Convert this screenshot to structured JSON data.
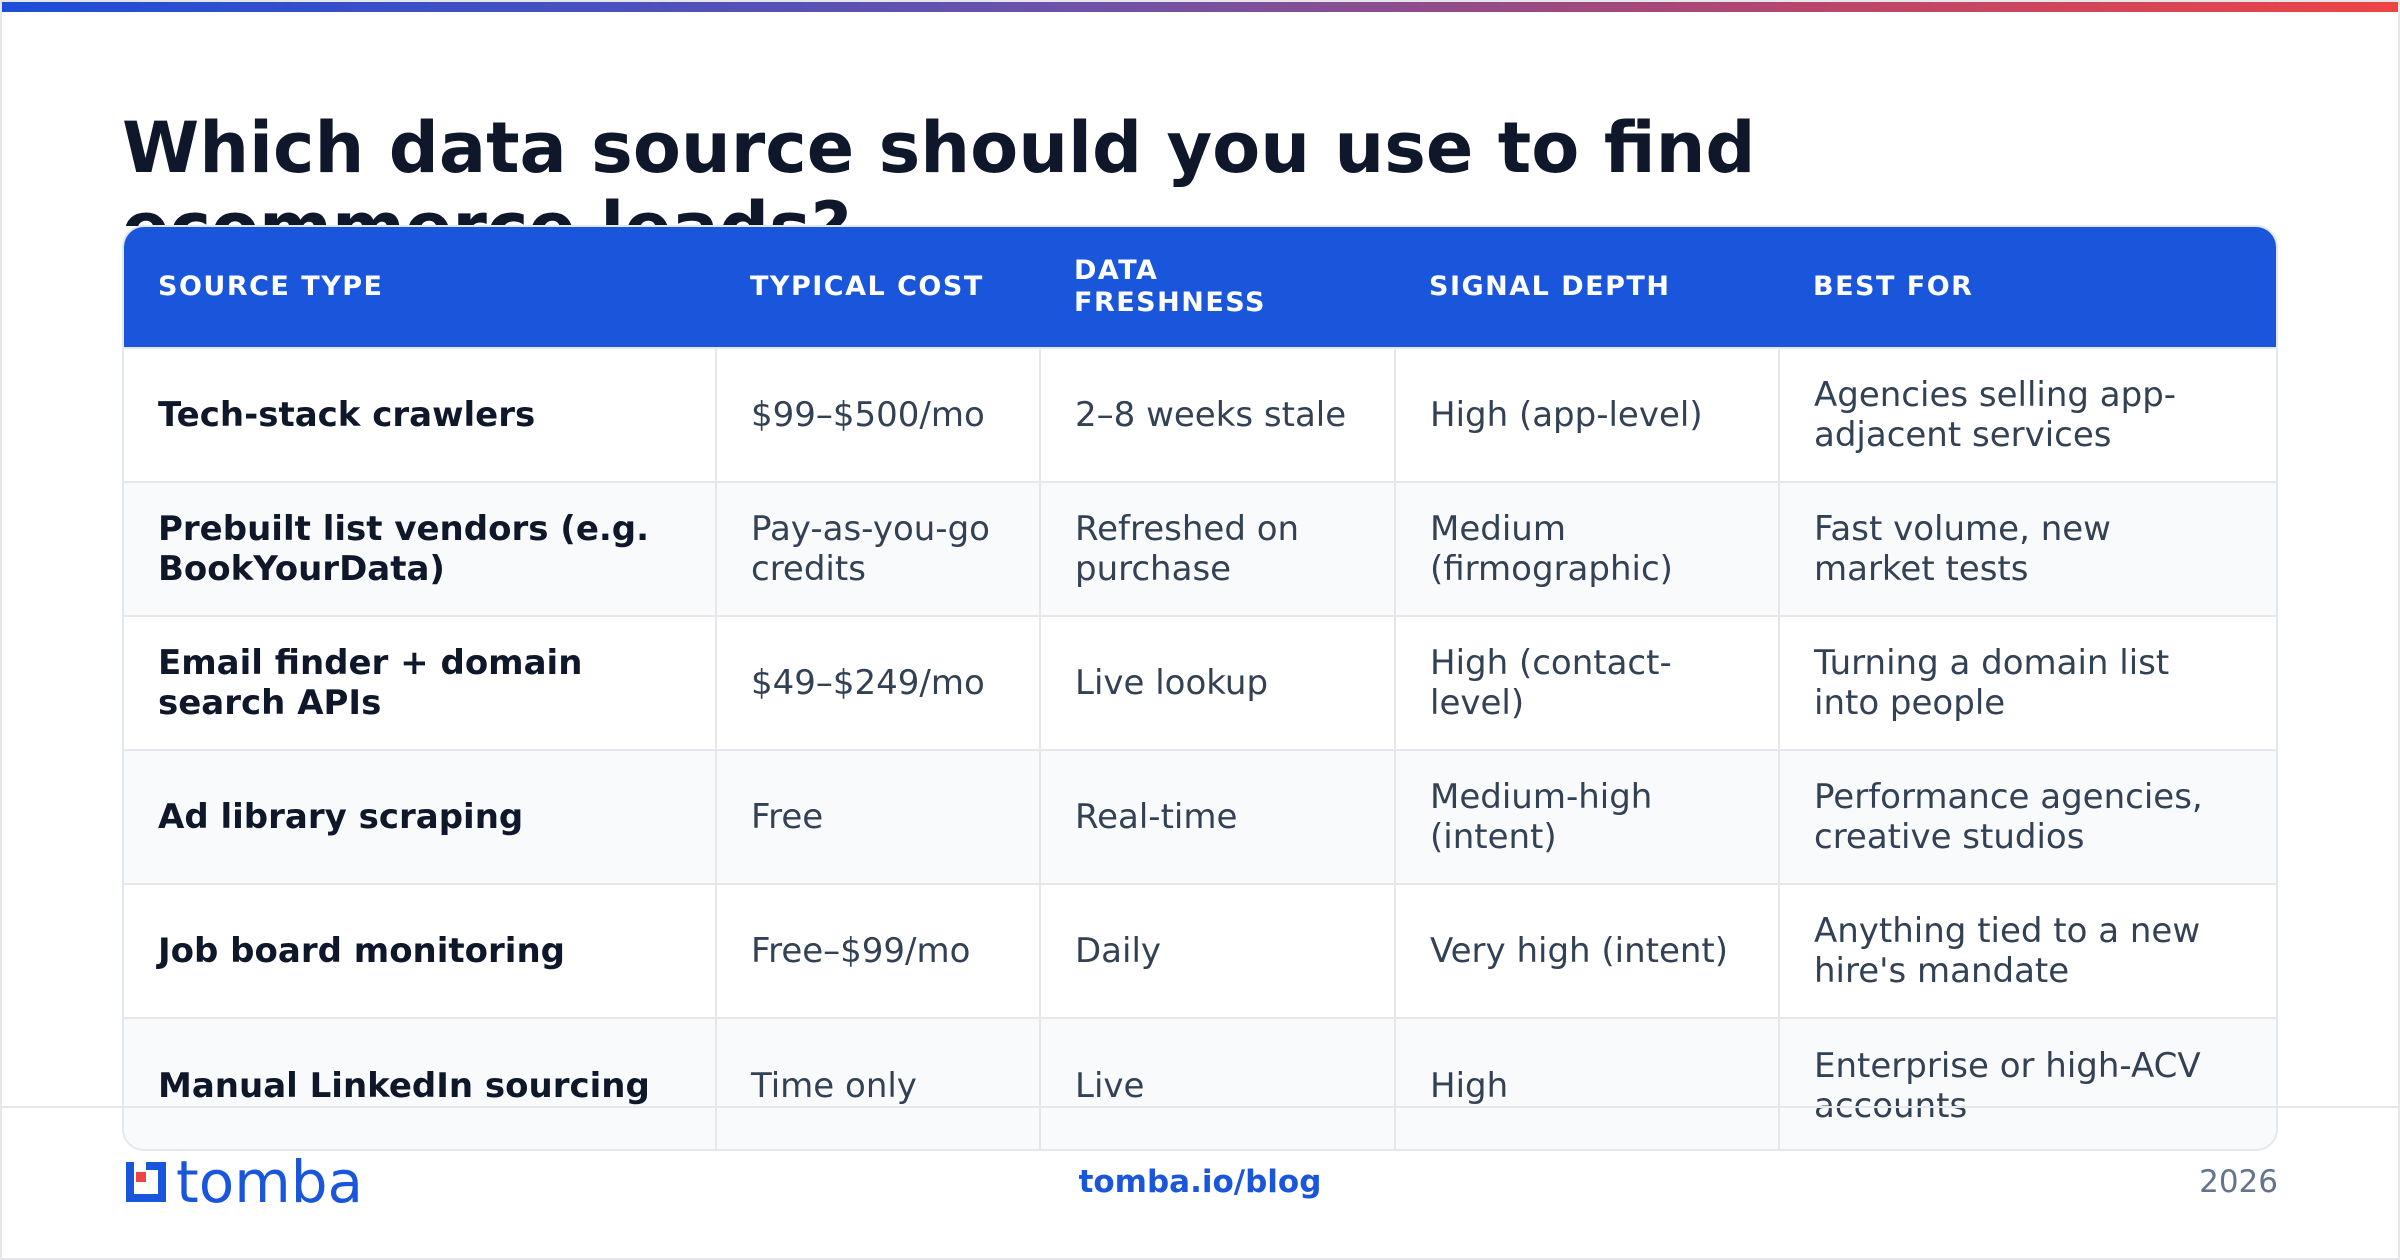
{
  "slide": {
    "title": "Which data source should you use to find ecommerce leads?"
  },
  "table": {
    "headers": [
      "Source type",
      "Typical cost",
      "Data freshness",
      "Signal depth",
      "Best for"
    ],
    "rows": [
      [
        "Tech-stack crawlers",
        "$99–$500/mo",
        "2–8 weeks stale",
        "High (app-level)",
        "Agencies selling app-adjacent services"
      ],
      [
        "Prebuilt list vendors (e.g. BookYourData)",
        "Pay-as-you-go credits",
        "Refreshed on purchase",
        "Medium (firmographic)",
        "Fast volume, new market tests"
      ],
      [
        "Email finder + domain search APIs",
        "$49–$249/mo",
        "Live lookup",
        "High (contact-level)",
        "Turning a domain list into people"
      ],
      [
        "Ad library scraping",
        "Free",
        "Real-time",
        "Medium-high (intent)",
        "Performance agencies, creative studios"
      ],
      [
        "Job board monitoring",
        "Free–$99/mo",
        "Daily",
        "Very high (intent)",
        "Anything tied to a new hire's mandate"
      ],
      [
        "Manual LinkedIn sourcing",
        "Time only",
        "Live",
        "High",
        "Enterprise or high-ACV accounts"
      ]
    ]
  },
  "footer": {
    "logo_text": "tomba",
    "logo_icon": "tomba-logo-icon",
    "url": "tomba.io/blog",
    "year": "2026"
  },
  "colors": {
    "brand_blue": "#1a56db",
    "accent_red": "#ef4444",
    "title_text": "#0f172a"
  }
}
